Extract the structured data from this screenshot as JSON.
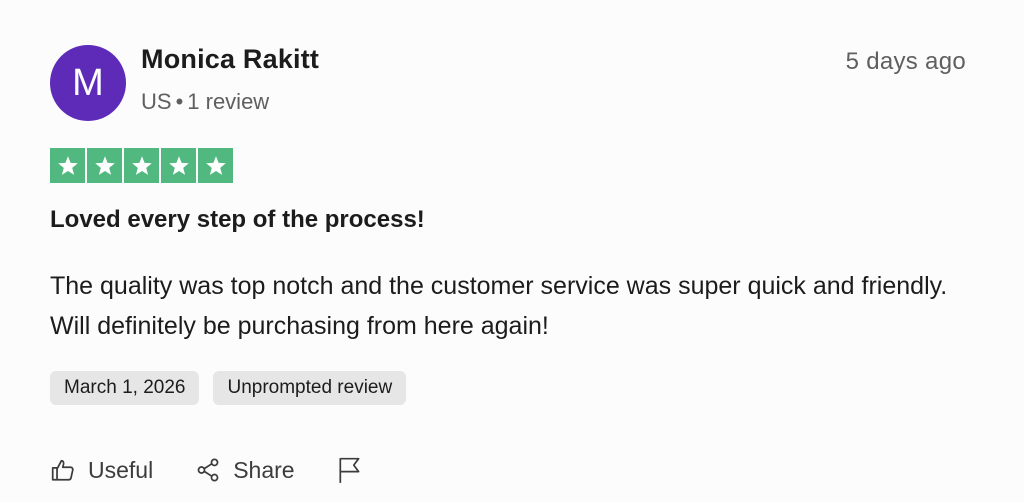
{
  "colors": {
    "avatar": "#5e2bb8",
    "star_bg": "#51b87f",
    "star_fg": "#ffffff"
  },
  "reviewer": {
    "initial": "M",
    "name": "Monica Rakitt",
    "country": "US",
    "separator": "•",
    "reviews": "1 review"
  },
  "posted_ago": "5 days ago",
  "rating": {
    "value": 5,
    "max": 5
  },
  "review": {
    "title": "Loved every step of the process!",
    "body": "The quality was top notch and the customer service was super quick and friendly. Will definitely be purchasing from here again!"
  },
  "tags": {
    "date": "March 1, 2026",
    "type": "Unprompted review"
  },
  "actions": {
    "useful": {
      "label": "Useful",
      "icon": "thumbs-up-icon"
    },
    "share": {
      "label": "Share",
      "icon": "share-icon"
    },
    "report": {
      "icon": "flag-icon"
    }
  }
}
